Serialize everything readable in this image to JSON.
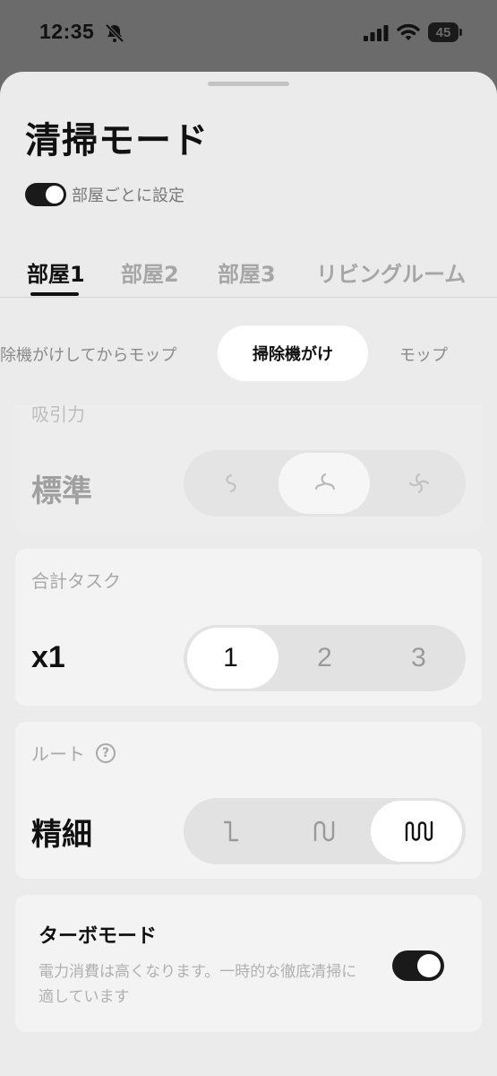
{
  "status_bar": {
    "time": "12:35",
    "battery": "45"
  },
  "sheet": {
    "title": "清掃モード",
    "room_toggle": {
      "label": "部屋ごとに設定",
      "on": true
    }
  },
  "room_tabs": [
    {
      "label": "部屋1",
      "active": true
    },
    {
      "label": "部屋2",
      "active": false
    },
    {
      "label": "部屋3",
      "active": false
    },
    {
      "label": "リビングルーム",
      "active": false
    }
  ],
  "modes": {
    "left": "掃除機がけしてからモップ",
    "selected": "掃除機がけ",
    "right": "モップ"
  },
  "suction": {
    "label": "吸引力",
    "value": "標準",
    "options": [
      "fan-low-icon",
      "fan-medium-icon",
      "fan-high-icon"
    ],
    "selected_index": 1
  },
  "tasks": {
    "label": "合計タスク",
    "value": "x1",
    "options": [
      "1",
      "2",
      "3"
    ],
    "selected_index": 0
  },
  "route": {
    "label": "ルート",
    "help": "?",
    "value": "精細",
    "options": [
      "route-quick-icon",
      "route-standard-icon",
      "route-fine-icon"
    ],
    "selected_index": 2
  },
  "turbo": {
    "title": "ターボモード",
    "description": "電力消費は高くなります。一時的な徹底清掃に適しています",
    "on": true
  },
  "colors": {
    "accent": "#1a1a1a",
    "sheet_bg": "#ebebeb",
    "card_bg": "#f3f3f3",
    "muted_text": "#a8a8a8"
  }
}
